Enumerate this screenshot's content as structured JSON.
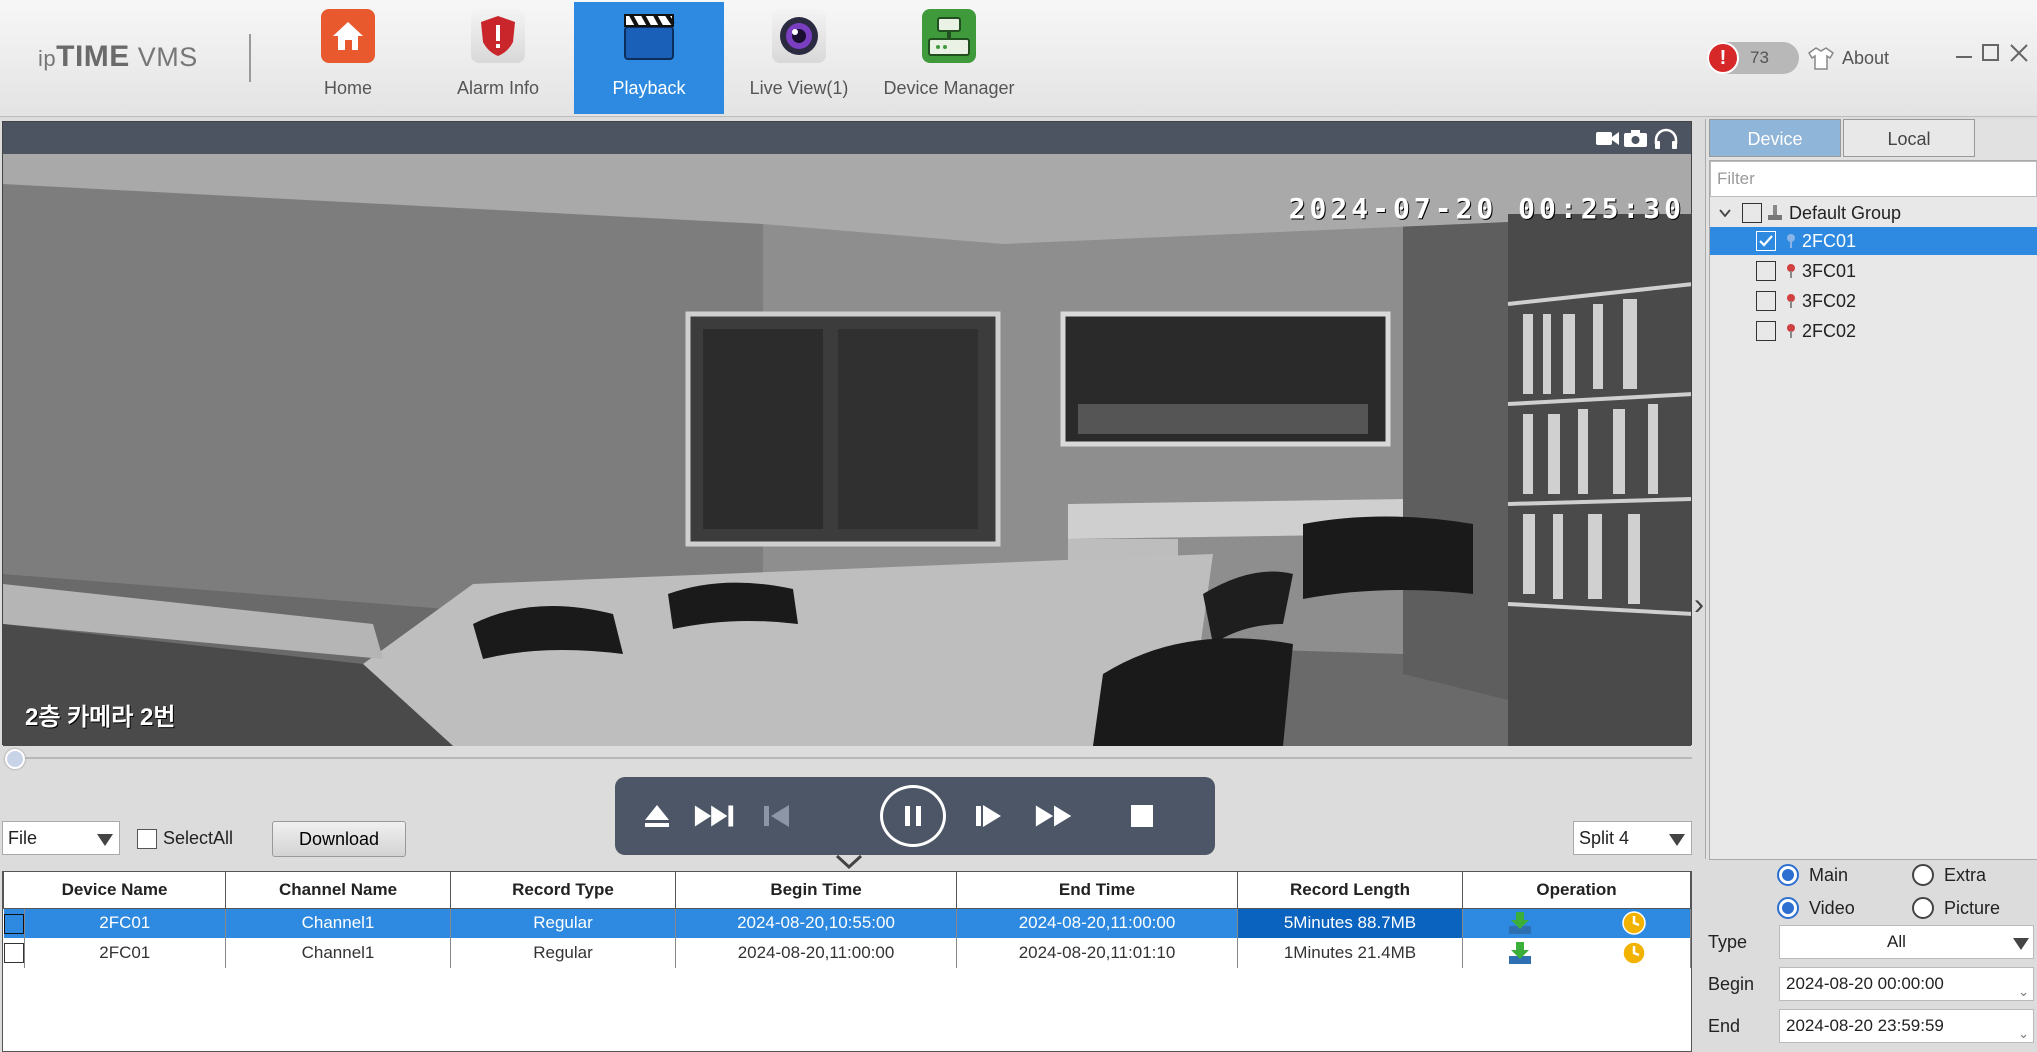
{
  "app": {
    "logo": {
      "ip": "ip",
      "time": "TIME",
      "vms": " VMS"
    },
    "nav": [
      {
        "label": "Home",
        "icon": "home-icon",
        "color": "#e8592e"
      },
      {
        "label": "Alarm Info",
        "icon": "alarm-shield-icon",
        "color": "#c8262b"
      },
      {
        "label": "Playback",
        "icon": "clapperboard-icon",
        "color": "#2d8ae0"
      },
      {
        "label": "Live View(1)",
        "icon": "camera-lens-icon",
        "color": "#7a3fc0"
      },
      {
        "label": "Device Manager",
        "icon": "device-manager-icon",
        "color": "#3f9a3c"
      }
    ],
    "active_nav": "Playback",
    "alarm_count": "73",
    "about_label": "About",
    "accent_color": "#2d8ae0"
  },
  "video": {
    "timestamp": "2024-07-20 00:25:30",
    "caption": "2층 카메라 2번",
    "toolbar_icons": [
      "video-record-icon",
      "snapshot-camera-icon",
      "headphones-icon"
    ],
    "seek_progress": 0.0
  },
  "controls": [
    "eject-icon",
    "fast-forward-end-icon",
    "step-back-icon",
    "pause-icon",
    "step-forward-icon",
    "fast-forward-icon",
    "stop-icon"
  ],
  "toolbar": {
    "file_select": "File",
    "selectall_label": "SelectAll",
    "download_label": "Download",
    "split_select": "Split 4"
  },
  "table": {
    "headers": [
      "Device Name",
      "Channel Name",
      "Record Type",
      "Begin Time",
      "End Time",
      "Record Length",
      "Operation"
    ],
    "rows": [
      {
        "device": "2FC01",
        "channel": "Channel1",
        "type": "Regular",
        "begin": "2024-08-20,10:55:00",
        "end": "2024-08-20,11:00:00",
        "length": "5Minutes 88.7MB",
        "selected": true
      },
      {
        "device": "2FC01",
        "channel": "Channel1",
        "type": "Regular",
        "begin": "2024-08-20,11:00:00",
        "end": "2024-08-20,11:01:10",
        "length": "1Minutes 21.4MB",
        "selected": false
      }
    ]
  },
  "sidebar": {
    "tabs": [
      "Device",
      "Local"
    ],
    "filter_placeholder": "Filter",
    "group": "Default Group",
    "devices": [
      {
        "name": "2FC01",
        "checked": true
      },
      {
        "name": "3FC01",
        "checked": false
      },
      {
        "name": "3FC02",
        "checked": false
      },
      {
        "name": "2FC02",
        "checked": false
      }
    ]
  },
  "search": {
    "stream_options": [
      "Main",
      "Extra"
    ],
    "media_options": [
      "Video",
      "Picture"
    ],
    "selected_stream": "Main",
    "selected_media": "Video",
    "type_label": "Type",
    "type_value": "All",
    "begin_label": "Begin",
    "begin_value": "2024-08-20 00:00:00",
    "end_label": "End",
    "end_value": "2024-08-20 23:59:59"
  }
}
